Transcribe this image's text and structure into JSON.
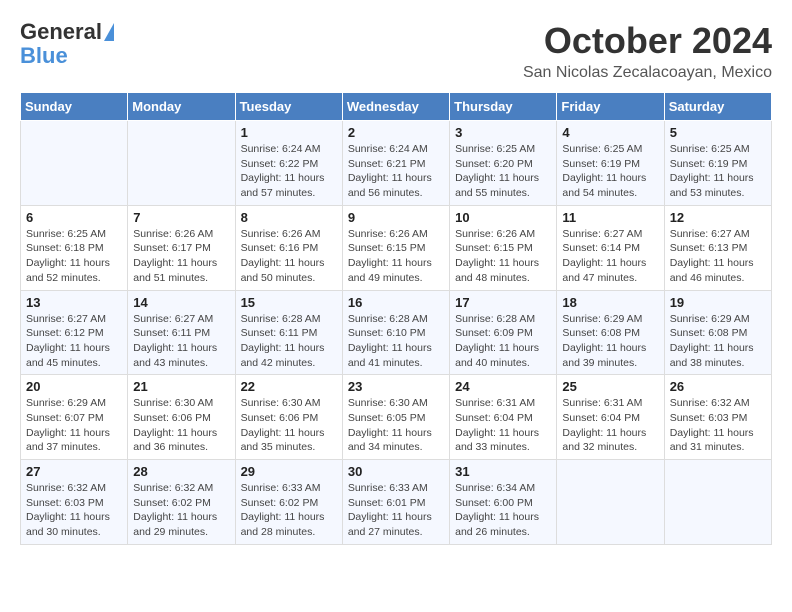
{
  "header": {
    "logo_line1": "General",
    "logo_line2": "Blue",
    "month": "October 2024",
    "location": "San Nicolas Zecalacoayan, Mexico"
  },
  "days_of_week": [
    "Sunday",
    "Monday",
    "Tuesday",
    "Wednesday",
    "Thursday",
    "Friday",
    "Saturday"
  ],
  "weeks": [
    [
      {
        "day": "",
        "info": ""
      },
      {
        "day": "",
        "info": ""
      },
      {
        "day": "1",
        "info": "Sunrise: 6:24 AM\nSunset: 6:22 PM\nDaylight: 11 hours and 57 minutes."
      },
      {
        "day": "2",
        "info": "Sunrise: 6:24 AM\nSunset: 6:21 PM\nDaylight: 11 hours and 56 minutes."
      },
      {
        "day": "3",
        "info": "Sunrise: 6:25 AM\nSunset: 6:20 PM\nDaylight: 11 hours and 55 minutes."
      },
      {
        "day": "4",
        "info": "Sunrise: 6:25 AM\nSunset: 6:19 PM\nDaylight: 11 hours and 54 minutes."
      },
      {
        "day": "5",
        "info": "Sunrise: 6:25 AM\nSunset: 6:19 PM\nDaylight: 11 hours and 53 minutes."
      }
    ],
    [
      {
        "day": "6",
        "info": "Sunrise: 6:25 AM\nSunset: 6:18 PM\nDaylight: 11 hours and 52 minutes."
      },
      {
        "day": "7",
        "info": "Sunrise: 6:26 AM\nSunset: 6:17 PM\nDaylight: 11 hours and 51 minutes."
      },
      {
        "day": "8",
        "info": "Sunrise: 6:26 AM\nSunset: 6:16 PM\nDaylight: 11 hours and 50 minutes."
      },
      {
        "day": "9",
        "info": "Sunrise: 6:26 AM\nSunset: 6:15 PM\nDaylight: 11 hours and 49 minutes."
      },
      {
        "day": "10",
        "info": "Sunrise: 6:26 AM\nSunset: 6:15 PM\nDaylight: 11 hours and 48 minutes."
      },
      {
        "day": "11",
        "info": "Sunrise: 6:27 AM\nSunset: 6:14 PM\nDaylight: 11 hours and 47 minutes."
      },
      {
        "day": "12",
        "info": "Sunrise: 6:27 AM\nSunset: 6:13 PM\nDaylight: 11 hours and 46 minutes."
      }
    ],
    [
      {
        "day": "13",
        "info": "Sunrise: 6:27 AM\nSunset: 6:12 PM\nDaylight: 11 hours and 45 minutes."
      },
      {
        "day": "14",
        "info": "Sunrise: 6:27 AM\nSunset: 6:11 PM\nDaylight: 11 hours and 43 minutes."
      },
      {
        "day": "15",
        "info": "Sunrise: 6:28 AM\nSunset: 6:11 PM\nDaylight: 11 hours and 42 minutes."
      },
      {
        "day": "16",
        "info": "Sunrise: 6:28 AM\nSunset: 6:10 PM\nDaylight: 11 hours and 41 minutes."
      },
      {
        "day": "17",
        "info": "Sunrise: 6:28 AM\nSunset: 6:09 PM\nDaylight: 11 hours and 40 minutes."
      },
      {
        "day": "18",
        "info": "Sunrise: 6:29 AM\nSunset: 6:08 PM\nDaylight: 11 hours and 39 minutes."
      },
      {
        "day": "19",
        "info": "Sunrise: 6:29 AM\nSunset: 6:08 PM\nDaylight: 11 hours and 38 minutes."
      }
    ],
    [
      {
        "day": "20",
        "info": "Sunrise: 6:29 AM\nSunset: 6:07 PM\nDaylight: 11 hours and 37 minutes."
      },
      {
        "day": "21",
        "info": "Sunrise: 6:30 AM\nSunset: 6:06 PM\nDaylight: 11 hours and 36 minutes."
      },
      {
        "day": "22",
        "info": "Sunrise: 6:30 AM\nSunset: 6:06 PM\nDaylight: 11 hours and 35 minutes."
      },
      {
        "day": "23",
        "info": "Sunrise: 6:30 AM\nSunset: 6:05 PM\nDaylight: 11 hours and 34 minutes."
      },
      {
        "day": "24",
        "info": "Sunrise: 6:31 AM\nSunset: 6:04 PM\nDaylight: 11 hours and 33 minutes."
      },
      {
        "day": "25",
        "info": "Sunrise: 6:31 AM\nSunset: 6:04 PM\nDaylight: 11 hours and 32 minutes."
      },
      {
        "day": "26",
        "info": "Sunrise: 6:32 AM\nSunset: 6:03 PM\nDaylight: 11 hours and 31 minutes."
      }
    ],
    [
      {
        "day": "27",
        "info": "Sunrise: 6:32 AM\nSunset: 6:03 PM\nDaylight: 11 hours and 30 minutes."
      },
      {
        "day": "28",
        "info": "Sunrise: 6:32 AM\nSunset: 6:02 PM\nDaylight: 11 hours and 29 minutes."
      },
      {
        "day": "29",
        "info": "Sunrise: 6:33 AM\nSunset: 6:02 PM\nDaylight: 11 hours and 28 minutes."
      },
      {
        "day": "30",
        "info": "Sunrise: 6:33 AM\nSunset: 6:01 PM\nDaylight: 11 hours and 27 minutes."
      },
      {
        "day": "31",
        "info": "Sunrise: 6:34 AM\nSunset: 6:00 PM\nDaylight: 11 hours and 26 minutes."
      },
      {
        "day": "",
        "info": ""
      },
      {
        "day": "",
        "info": ""
      }
    ]
  ]
}
